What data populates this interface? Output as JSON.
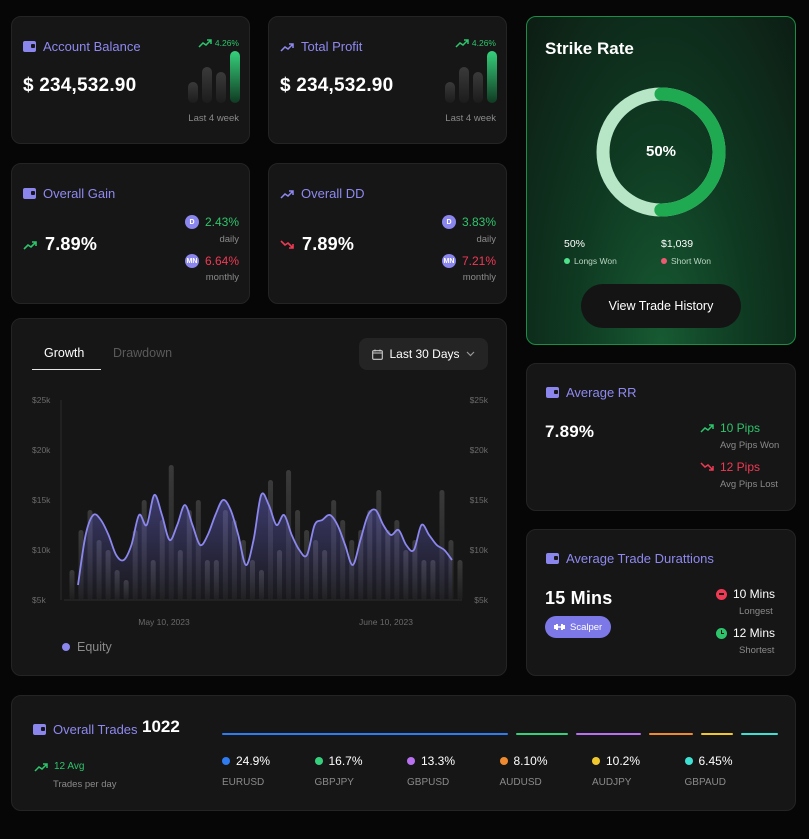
{
  "account_balance": {
    "title": "Account Balance",
    "value": "$ 234,532.90",
    "change": "4.26%",
    "period": "Last 4 week",
    "bars": [
      0.4,
      0.7,
      0.6,
      1.0
    ]
  },
  "total_profit": {
    "title": "Total Profit",
    "value": "$ 234,532.90",
    "change": "4.26%",
    "period": "Last 4 week",
    "bars": [
      0.4,
      0.7,
      0.6,
      1.0
    ]
  },
  "overall_gain": {
    "title": "Overall Gain",
    "value": "7.89%",
    "daily_badge": "D",
    "daily": "2.43%",
    "daily_label": "daily",
    "monthly_badge": "MN",
    "monthly": "6.64%",
    "monthly_label": "monthly"
  },
  "overall_dd": {
    "title": "Overall DD",
    "value": "7.89%",
    "daily_badge": "D",
    "daily": "3.83%",
    "daily_label": "daily",
    "monthly_badge": "MN",
    "monthly": "7.21%",
    "monthly_label": "monthly"
  },
  "strike_rate": {
    "title": "Strike Rate",
    "percent": "50%",
    "progress": 0.5,
    "longs_value": "50%",
    "longs_label": "Longs Won",
    "short_value": "$1,039",
    "short_label": "Short Won",
    "button": "View Trade History"
  },
  "growth": {
    "tabs": [
      "Growth",
      "Drawdown"
    ],
    "range_label": "Last 30 Days",
    "y_ticks": [
      "$25k",
      "$20k",
      "$15k",
      "$10k",
      "$5k"
    ],
    "x_labels": [
      "May 10, 2023",
      "June 10, 2023"
    ],
    "legend": "Equity"
  },
  "chart_data": {
    "type": "line",
    "xlabel": "",
    "ylabel": "",
    "ylim": [
      5,
      25
    ],
    "x_labels": [
      "May 10, 2023",
      "June 10, 2023"
    ],
    "series": [
      {
        "name": "Equity",
        "values": [
          6.5,
          11.5,
          13.5,
          13,
          11.5,
          9.5,
          9,
          10.5,
          13.5,
          12.5,
          15.5,
          13.5,
          11,
          12.5,
          14.5,
          12.5,
          10.5,
          11.5,
          13.5,
          15,
          14,
          11.5,
          8.5,
          11,
          15.5,
          14.5,
          12.5,
          13.5,
          11.5,
          10,
          9.5,
          12.5,
          13,
          13.5,
          12.5,
          10.5,
          8.5,
          11,
          13.5,
          14,
          12.5,
          11.5,
          12,
          10.5,
          10,
          12.5,
          11.5,
          10.5,
          10,
          9
        ]
      },
      {
        "name": "Volume",
        "values": [
          8,
          12,
          14,
          11,
          10,
          8,
          7,
          12,
          15,
          9,
          13,
          18.5,
          10,
          14,
          15,
          9,
          9,
          14,
          13,
          11,
          9,
          8,
          17,
          10,
          18,
          14,
          12,
          11,
          10,
          15,
          13,
          11,
          12,
          14,
          16,
          12,
          13,
          10,
          11,
          9,
          9,
          16,
          11,
          9
        ]
      }
    ]
  },
  "average_rr": {
    "title": "Average RR",
    "value": "7.89%",
    "won": "10 Pips",
    "won_label": "Avg Pips Won",
    "lost": "12 Pips",
    "lost_label": "Avg Pips Lost"
  },
  "average_duration": {
    "title": "Average Trade Durattions",
    "value": "15 Mins",
    "tag": "Scalper",
    "longest": "10 Mins",
    "longest_label": "Longest",
    "shortest": "12 Mins",
    "shortest_label": "Shortest"
  },
  "overall_trades": {
    "title": "Overall Trades",
    "count": "1022",
    "avg": "12 Avg",
    "avg_label": "Trades per day",
    "pairs": [
      {
        "pct": "24.9%",
        "name": "EURUSD",
        "color": "#2f7bf0"
      },
      {
        "pct": "16.7%",
        "name": "GBPJPY",
        "color": "#36d07c"
      },
      {
        "pct": "13.3%",
        "name": "GBPUSD",
        "color": "#b870f0"
      },
      {
        "pct": "8.10%",
        "name": "AUDUSD",
        "color": "#f08a2e"
      },
      {
        "pct": "10.2%",
        "name": "AUDJPY",
        "color": "#f0c82e"
      },
      {
        "pct": "6.45%",
        "name": "GBPAUD",
        "color": "#3ee0d4"
      }
    ]
  }
}
